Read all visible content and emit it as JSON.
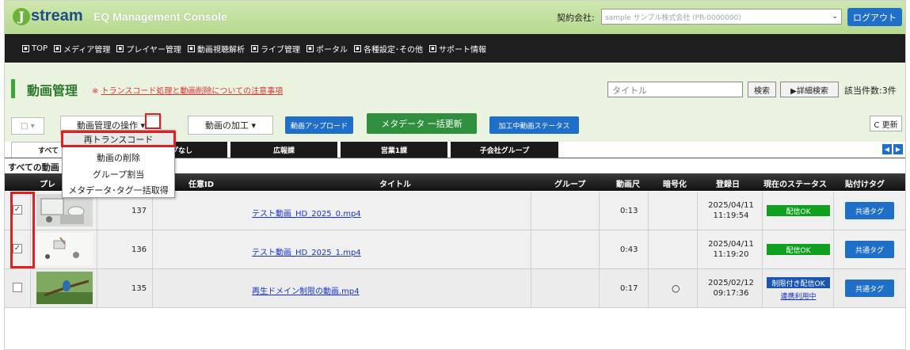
{
  "header": {
    "logo_mark": "J",
    "logo_text": "stream",
    "app_title": "EQ Management Console",
    "company_label": "契約会社:",
    "company_value": "sample  サンプル株式会社  (PR-0000000)",
    "logout_label": "ログアウト"
  },
  "nav": {
    "items": [
      {
        "label": "TOP"
      },
      {
        "label": "メディア管理"
      },
      {
        "label": "プレイヤー管理"
      },
      {
        "label": "動画視聴解析"
      },
      {
        "label": "ライブ管理"
      },
      {
        "label": "ポータル"
      },
      {
        "label": "各種設定･その他"
      },
      {
        "label": "サポート情報"
      }
    ]
  },
  "page": {
    "title": "動画管理",
    "notice_mark": "※",
    "notice_link": "トランスコード処理と動画削除についての注意事項",
    "search_placeholder": "タイトル",
    "search_label": "検索",
    "advanced_label": "▶詳細検索",
    "count_label": "該当件数:3件"
  },
  "toolbar": {
    "select_all": "□ ▾",
    "ops_label": "動画管理の操作 ▾",
    "process_label": "動画の加工 ▾",
    "upload_label": "動画アップロード",
    "meta_label": "メタデータ 一括更新",
    "status_label": "加工中動画ステータス",
    "refresh_label": "C 更新"
  },
  "dropdown": {
    "items": [
      {
        "label": "再トランスコード"
      },
      {
        "label": "動画の削除"
      },
      {
        "label": "グループ割当"
      },
      {
        "label": "メタデータ･タグ一括取得"
      }
    ]
  },
  "tabs": [
    {
      "label": "すべて"
    },
    {
      "label": "プなし"
    },
    {
      "label": "広報課"
    },
    {
      "label": "営業1課"
    },
    {
      "label": "子会社グループ"
    }
  ],
  "tab_arrows": {
    "left": "◀",
    "right": "▶"
  },
  "section_label": "すべての動画",
  "table": {
    "headers": {
      "preview": "プレ",
      "id": "任意ID",
      "title": "タイトル",
      "group": "グループ",
      "duration": "動画尺",
      "encryption": "暗号化",
      "registered": "登録日",
      "status": "現在のステータス",
      "tag": "貼付けタグ"
    },
    "rows": [
      {
        "checked": "✓",
        "num": "137",
        "title": "テスト動画_HD_2025_0.mp4",
        "duration": "0:13",
        "encryption": "",
        "date": "2025/04/11",
        "time": "11:19:54",
        "status": "配信OK",
        "coop": "",
        "tag": "共通タグ"
      },
      {
        "checked": "✓",
        "num": "136",
        "title": "テスト動画_HD_2025_1.mp4",
        "duration": "0:43",
        "encryption": "",
        "date": "2025/04/11",
        "time": "11:19:20",
        "status": "配信OK",
        "coop": "",
        "tag": "共通タグ"
      },
      {
        "checked": "",
        "num": "135",
        "title": "再生ドメイン制限の動画.mp4",
        "duration": "0:17",
        "encryption": "○",
        "date": "2025/02/12",
        "time": "09:17:36",
        "status": "制限付き配信OK",
        "coop": "連携利用中",
        "tag": "共通タグ"
      }
    ]
  },
  "colors": {
    "accent_blue": "#1f6fc9",
    "header_green": "#b5d98e",
    "status_ok": "#10a020",
    "highlight_red": "#e02020"
  }
}
